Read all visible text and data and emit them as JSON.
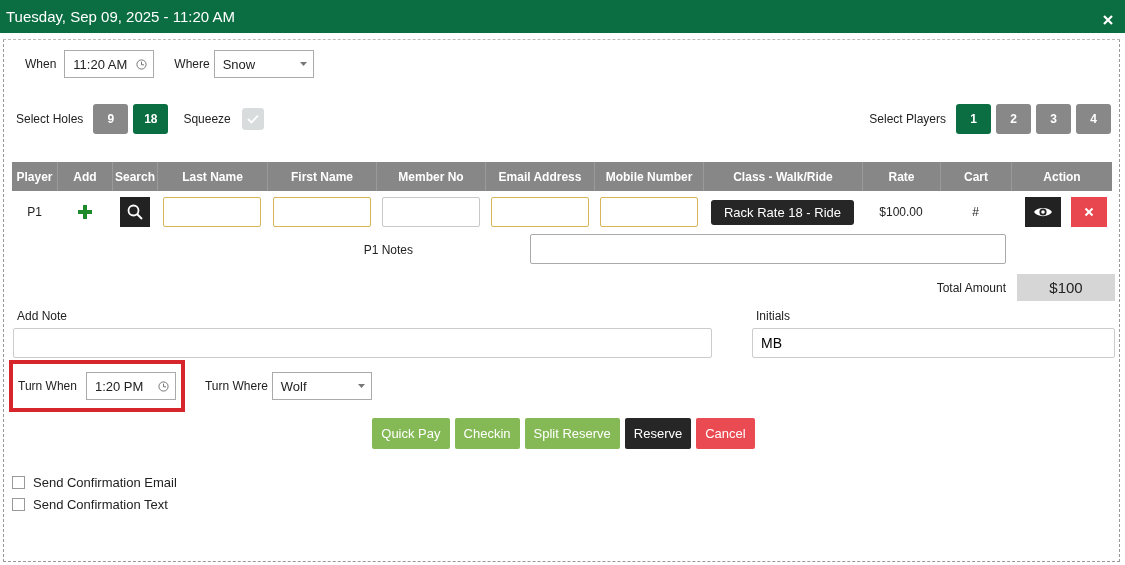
{
  "window": {
    "title": "Tuesday, Sep 09, 2025 - 11:20 AM"
  },
  "schedule": {
    "when": {
      "label": "When",
      "value": "11:20 AM"
    },
    "where": {
      "label": "Where",
      "value": "Snow"
    }
  },
  "holes": {
    "label": "Select Holes",
    "options": [
      {
        "label": "9",
        "selected": false
      },
      {
        "label": "18",
        "selected": true
      }
    ]
  },
  "squeeze": {
    "label": "Squeeze",
    "checked": true,
    "disabled": true
  },
  "players": {
    "label": "Select Players",
    "options": [
      {
        "label": "1",
        "selected": true
      },
      {
        "label": "2",
        "selected": false
      },
      {
        "label": "3",
        "selected": false
      },
      {
        "label": "4",
        "selected": false
      }
    ]
  },
  "table": {
    "columns": [
      "Player",
      "Add",
      "Search",
      "Last Name",
      "First Name",
      "Member No",
      "Email Address",
      "Mobile Number",
      "Class - Walk/Ride",
      "Rate",
      "Cart",
      "Action"
    ],
    "rows": [
      {
        "player": "P1",
        "fields": [
          {
            "highlighted": true
          },
          {
            "highlighted": true
          },
          {
            "highlighted": false
          },
          {
            "highlighted": true
          },
          {
            "highlighted": true
          }
        ],
        "class": "Rack Rate 18 - Ride",
        "rate": "$100.00",
        "cart": "#",
        "notes_label": "P1 Notes"
      }
    ]
  },
  "total": {
    "label": "Total Amount",
    "value": "$100"
  },
  "add_note": {
    "label": "Add Note"
  },
  "initials": {
    "label": "Initials",
    "value": "MB"
  },
  "turn": {
    "when": {
      "label": "Turn When",
      "value": "1:20 PM",
      "highlighted": true
    },
    "where": {
      "label": "Turn Where",
      "value": "Wolf"
    }
  },
  "buttons": [
    {
      "label": "Quick Pay",
      "kind": "success"
    },
    {
      "label": "Checkin",
      "kind": "success"
    },
    {
      "label": "Split Reserve",
      "kind": "success"
    },
    {
      "label": "Reserve",
      "kind": "dark"
    },
    {
      "label": "Cancel",
      "kind": "danger"
    }
  ],
  "options": [
    {
      "label": "Send Confirmation Email",
      "checked": false
    },
    {
      "label": "Send Confirmation Text",
      "checked": false
    }
  ]
}
